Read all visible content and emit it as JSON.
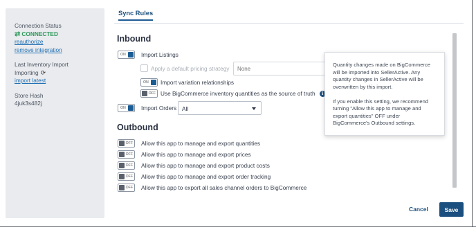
{
  "sidebar": {
    "connection_status_label": "Connection Status",
    "connected_text": "CONNECTED",
    "connected_color": "#2e9a5b",
    "reauthorize_link": "reauthorize",
    "remove_integration_link": "remove integration",
    "last_import_label": "Last Inventory Import",
    "importing_text": "Importing",
    "import_latest_link": "import latest",
    "store_hash_label": "Store Hash",
    "store_hash_value": "4juk3s482j"
  },
  "tabs": [
    {
      "label": "Sync Rules",
      "active": true
    }
  ],
  "inbound": {
    "title": "Inbound",
    "import_listings": {
      "label": "Import Listings",
      "toggle_text": "ON",
      "on": true
    },
    "pricing_strategy": {
      "label": "Apply a default pricing strategy",
      "placeholder": "None",
      "checked": false,
      "disabled": true
    },
    "variation_relationships": {
      "label": "Import variation relationships",
      "toggle_text": "ON",
      "on": true
    },
    "use_quantities": {
      "label": "Use BigCommerce inventory quantities as the source of truth",
      "toggle_text": "OFF",
      "on": false
    },
    "import_orders": {
      "label": "Import Orders",
      "toggle_text": "ON",
      "on": true,
      "selected": "All"
    }
  },
  "outbound": {
    "title": "Outbound",
    "items": [
      {
        "label": "Allow this app to manage and export quantities",
        "toggle_text": "OFF"
      },
      {
        "label": "Allow this app to manage and export prices",
        "toggle_text": "OFF"
      },
      {
        "label": "Allow this app to manage and export product costs",
        "toggle_text": "OFF"
      },
      {
        "label": "Allow this app to manage and export order tracking",
        "toggle_text": "OFF"
      },
      {
        "label": "Allow this app to export all sales channel orders to BigCommerce",
        "toggle_text": "OFF"
      }
    ]
  },
  "tooltip": {
    "paragraph1": "Quantity changes made on BigCommerce will be imported into SellerActive. Any quantity changes in SellerActive will be overwritten by this import.",
    "paragraph2": "If you enable this setting, we recommend turning \"Allow this app to manage and export quantities\" OFF under BigCommerce's Outbound settings."
  },
  "footer": {
    "cancel_label": "Cancel",
    "save_label": "Save"
  },
  "colors": {
    "accent": "#1b4f80",
    "toggle_on_knob": "#1a5c94",
    "toggle_off_knob": "#5a616c"
  },
  "icons": {
    "connected": "swap-arrows-icon",
    "importing": "refresh-icon",
    "info": "info-icon",
    "dropdown": "chevron-down-icon"
  }
}
